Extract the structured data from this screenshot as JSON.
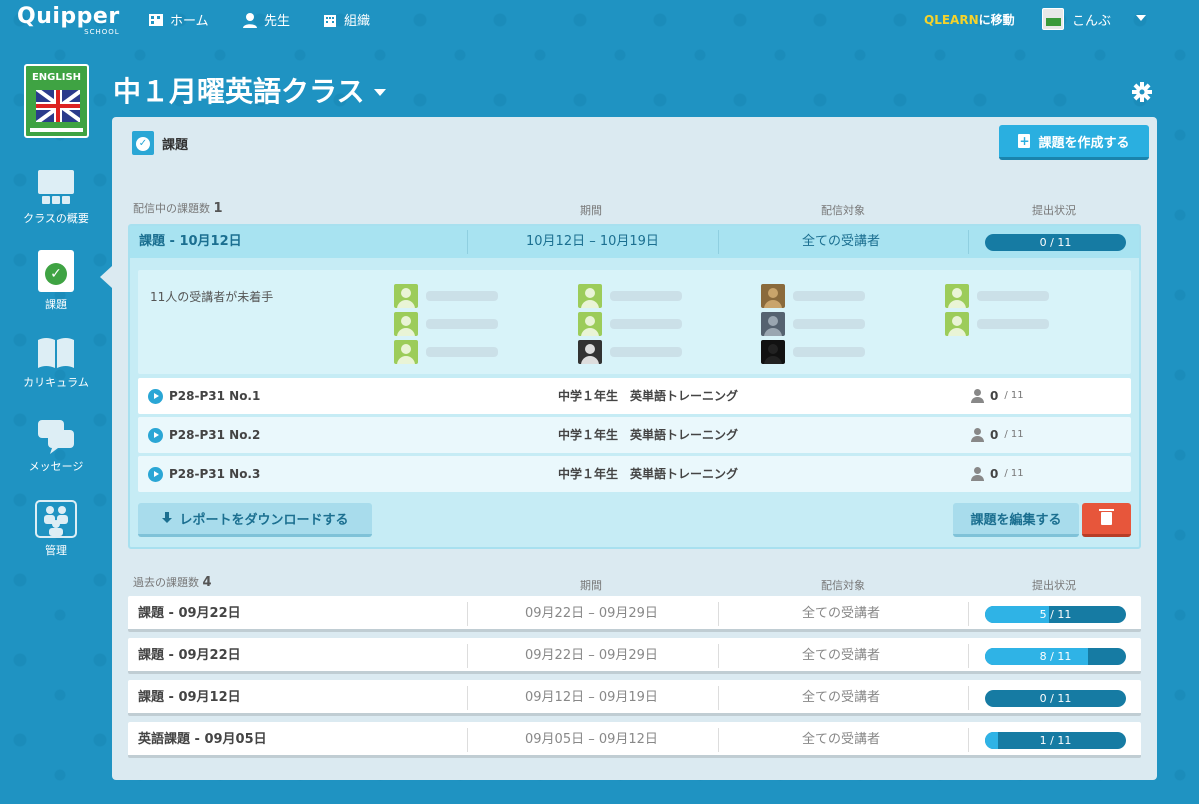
{
  "brand": {
    "name": "Quipper",
    "sub": "SCHOOL"
  },
  "nav": {
    "home": "ホーム",
    "teacher": "先生",
    "org": "組織"
  },
  "qlearn": {
    "highlight": "QLEARN",
    "rest": "に移動"
  },
  "user": {
    "name": "こんぶ"
  },
  "book": {
    "label": "ENGLISH"
  },
  "sidebar": [
    {
      "label": "クラスの概要",
      "icon": "class-overview-icon"
    },
    {
      "label": "課題",
      "icon": "assignment-icon"
    },
    {
      "label": "カリキュラム",
      "icon": "curriculum-icon"
    },
    {
      "label": "メッセージ",
      "icon": "message-icon"
    },
    {
      "label": "管理",
      "icon": "admin-icon"
    }
  ],
  "class_title": "中１月曜英語クラス",
  "panel": {
    "title": "課題",
    "create_label": "課題を作成する"
  },
  "active": {
    "header_label": "配信中の課題数",
    "count": "1",
    "col_period": "期間",
    "col_target": "配信対象",
    "col_status": "提出状況",
    "row": {
      "name": "課題 - 10月12日",
      "period": "10月12日 – 10月19日",
      "target": "全ての受講者",
      "progress": "0 / 11",
      "fraction": 0
    },
    "not_started": "11人の受講者が未着手",
    "tasks": [
      {
        "name": "P28-P31 No.1",
        "course": "中学１年生　英単語トレーニング",
        "done": "0",
        "total": "/ 11"
      },
      {
        "name": "P28-P31 No.2",
        "course": "中学１年生　英単語トレーニング",
        "done": "0",
        "total": "/ 11"
      },
      {
        "name": "P28-P31 No.3",
        "course": "中学１年生　英単語トレーニング",
        "done": "0",
        "total": "/ 11"
      }
    ],
    "download_label": "レポートをダウンロードする",
    "edit_label": "課題を編集する"
  },
  "past": {
    "header_label": "過去の課題数",
    "count": "4",
    "col_period": "期間",
    "col_target": "配信対象",
    "col_status": "提出状況",
    "rows": [
      {
        "name": "課題 - 09月22日",
        "period": "09月22日 – 09月29日",
        "target": "全ての受講者",
        "progress": "5 / 11",
        "fraction": 0.4545
      },
      {
        "name": "課題 - 09月22日",
        "period": "09月22日 – 09月29日",
        "target": "全ての受講者",
        "progress": "8 / 11",
        "fraction": 0.7273
      },
      {
        "name": "課題 - 09月12日",
        "period": "09月12日 – 09月19日",
        "target": "全ての受講者",
        "progress": "0 / 11",
        "fraction": 0
      },
      {
        "name": "英語課題 - 09月05日",
        "period": "09月05日 – 09月12日",
        "target": "全ての受講者",
        "progress": "1 / 11",
        "fraction": 0.0909
      }
    ]
  },
  "colors": {
    "bg": "#1f93c2",
    "accent": "#2aafe0",
    "danger": "#e7563b",
    "progress": "#167ba3",
    "progress_fill": "#2fb3e6"
  }
}
